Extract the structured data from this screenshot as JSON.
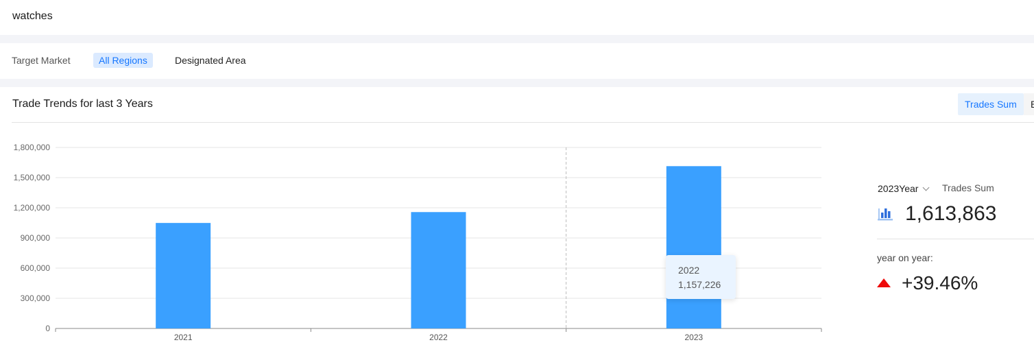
{
  "search": {
    "query": "watches"
  },
  "filters": {
    "label": "Target Market",
    "options": [
      {
        "label": "All Regions",
        "active": true
      },
      {
        "label": "Designated Area",
        "active": false
      }
    ]
  },
  "section": {
    "title": "Trade Trends for last 3 Years",
    "tabs": [
      {
        "label": "Trades Sum",
        "active": true
      },
      {
        "label": "B"
      }
    ]
  },
  "chart_data": {
    "type": "bar",
    "categories": [
      "2021",
      "2022",
      "2023"
    ],
    "values": [
      1049000,
      1157226,
      1613863
    ],
    "ylim": [
      0,
      1800000
    ],
    "yticks": [
      "0",
      "300,000",
      "600,000",
      "900,000",
      "1,200,000",
      "1,500,000",
      "1,800,000"
    ],
    "grid": true,
    "color": "#3aa0ff",
    "hover_category": "2023",
    "tooltip": {
      "label": "2022",
      "value": "1,157,226"
    }
  },
  "side_panel": {
    "year_select": "2023Year",
    "metric_label": "Trades Sum",
    "metric_icon": "bar-chart-icon",
    "metric_value": "1,613,863",
    "yoy_label": "year on year:",
    "yoy_icon": "up-triangle-icon",
    "yoy_value": "+39.46%",
    "colors": {
      "up": "#ee0a0a",
      "accent": "#1677ff"
    }
  }
}
